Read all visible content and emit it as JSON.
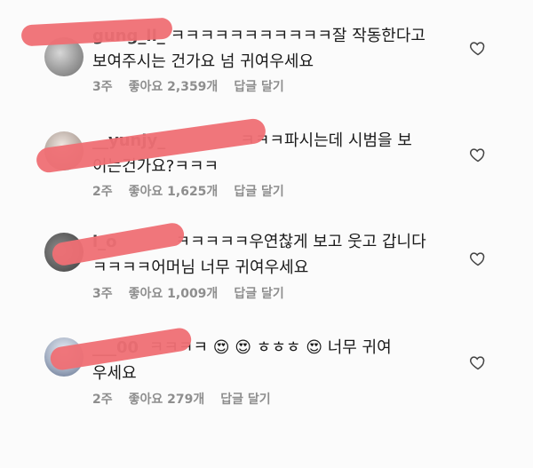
{
  "comments": [
    {
      "username": "gung_ll_",
      "text_line1": "ㅋㅋㅋㅋㅋㅋㅋㅋㅋㅋㅋ잘 작동한다고",
      "text_line2": "보여주시는 건가요 넘 귀여우세요",
      "time": "3주",
      "likes": "좋아요 2,359개",
      "reply": "답글 달기"
    },
    {
      "username": "__yunjy_",
      "text_line1": "ㅋㅋㅋ파시는데  시범을  보",
      "text_line2": "이는건가요?ㅋㅋㅋ",
      "time": "2주",
      "likes": "좋아요 1,625개",
      "reply": "답글 달기"
    },
    {
      "username": "i_o",
      "text_line1": "ㅋㅋㅋㅋㅋ우연찮게 보고 웃고 갑니다",
      "text_line2": "ㅋㅋㅋㅋ어머님 너무 귀여우세요",
      "time": "3주",
      "likes": "좋아요 1,009개",
      "reply": "답글 달기"
    },
    {
      "username": "___00",
      "text_part1": "ㅋㅋㅋㅋ",
      "emoji1": "😍",
      "emoji2": "😍",
      "text_part2": " ㅎㅎㅎ",
      "emoji3": "😍",
      "text_part3": " 너무 귀여",
      "text_line2": "우세요",
      "time": "2주",
      "likes": "좋아요 279개",
      "reply": "답글 달기"
    }
  ],
  "icons": {
    "heart": "heart-outline-icon"
  },
  "colors": {
    "redaction": "#ef6f74",
    "meta_text": "#8e8e8e",
    "text": "#1a1a1a"
  }
}
